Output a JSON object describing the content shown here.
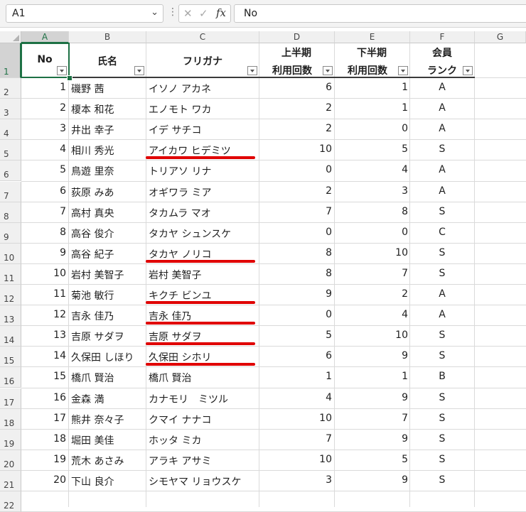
{
  "formula_bar": {
    "name_box": "A1",
    "formula": "No",
    "fx_label": "fx",
    "cancel_glyph": "✕",
    "enter_glyph": "✓",
    "dropdown_glyph": "⌄",
    "dots_glyph": "⋮"
  },
  "columns": [
    "A",
    "B",
    "C",
    "D",
    "E",
    "F",
    "G"
  ],
  "row_numbers": [
    "1",
    "2",
    "3",
    "4",
    "5",
    "6",
    "7",
    "8",
    "9",
    "10",
    "11",
    "12",
    "13",
    "14",
    "15",
    "16",
    "17",
    "18",
    "19",
    "20",
    "21",
    "22"
  ],
  "header": {
    "no": "No",
    "name": "氏名",
    "kana": "フリガナ",
    "first_half_line1": "上半期",
    "first_half_line2": "利用回数",
    "second_half_line1": "下半期",
    "second_half_line2": "利用回数",
    "rank_line1": "会員",
    "rank_line2": "ランク"
  },
  "rows": [
    {
      "no": "1",
      "name": "磯野 茜",
      "kana": "イソノ アカネ",
      "h1": "6",
      "h2": "1",
      "rank": "A"
    },
    {
      "no": "2",
      "name": "榎本 和花",
      "kana": "エノモト ワカ",
      "h1": "2",
      "h2": "1",
      "rank": "A"
    },
    {
      "no": "3",
      "name": "井出 幸子",
      "kana": "イデ サチコ",
      "h1": "2",
      "h2": "0",
      "rank": "A"
    },
    {
      "no": "4",
      "name": "相川 秀光",
      "kana": "アイカワ ヒデミツ",
      "h1": "10",
      "h2": "5",
      "rank": "S"
    },
    {
      "no": "5",
      "name": "鳥遊 里奈",
      "kana": "トリアソ リナ",
      "h1": "0",
      "h2": "4",
      "rank": "A"
    },
    {
      "no": "6",
      "name": "荻原 みあ",
      "kana": "オギワラ ミア",
      "h1": "2",
      "h2": "3",
      "rank": "A"
    },
    {
      "no": "7",
      "name": "高村 真央",
      "kana": "タカムラ マオ",
      "h1": "7",
      "h2": "8",
      "rank": "S"
    },
    {
      "no": "8",
      "name": "高谷 俊介",
      "kana": "タカヤ シュンスケ",
      "h1": "0",
      "h2": "0",
      "rank": "C"
    },
    {
      "no": "9",
      "name": "高谷 紀子",
      "kana": "タカヤ ノリコ",
      "h1": "8",
      "h2": "10",
      "rank": "S"
    },
    {
      "no": "10",
      "name": "岩村 美智子",
      "kana": "岩村 美智子",
      "h1": "8",
      "h2": "7",
      "rank": "S"
    },
    {
      "no": "11",
      "name": "菊池 敏行",
      "kana": "キクチ ビンユ",
      "h1": "9",
      "h2": "2",
      "rank": "A"
    },
    {
      "no": "12",
      "name": "吉永 佳乃",
      "kana": "吉永 佳乃",
      "h1": "0",
      "h2": "4",
      "rank": "A"
    },
    {
      "no": "13",
      "name": "吉原 サダヲ",
      "kana": "吉原 サダヲ",
      "h1": "5",
      "h2": "10",
      "rank": "S"
    },
    {
      "no": "14",
      "name": "久保田 しほり",
      "kana": "久保田 シホリ",
      "h1": "6",
      "h2": "9",
      "rank": "S"
    },
    {
      "no": "15",
      "name": "橋爪 賢治",
      "kana": "橋爪 賢治",
      "h1": "1",
      "h2": "1",
      "rank": "B"
    },
    {
      "no": "16",
      "name": "金森 満",
      "kana": "カナモリ　ミツル",
      "h1": "4",
      "h2": "9",
      "rank": "S"
    },
    {
      "no": "17",
      "name": "熊井 奈々子",
      "kana": "クマイ ナナコ",
      "h1": "10",
      "h2": "7",
      "rank": "S"
    },
    {
      "no": "18",
      "name": "堀田 美佳",
      "kana": "ホッタ ミカ",
      "h1": "7",
      "h2": "9",
      "rank": "S"
    },
    {
      "no": "19",
      "name": "荒木 あさみ",
      "kana": "アラキ アサミ",
      "h1": "10",
      "h2": "5",
      "rank": "S"
    },
    {
      "no": "20",
      "name": "下山 良介",
      "kana": "シモヤマ リョウスケ",
      "h1": "3",
      "h2": "9",
      "rank": "S"
    }
  ],
  "highlight_color": "#e00000",
  "selection_color": "#1e7145",
  "underlined_row_numbers": [
    "5",
    "10",
    "12",
    "13",
    "14",
    "15"
  ]
}
